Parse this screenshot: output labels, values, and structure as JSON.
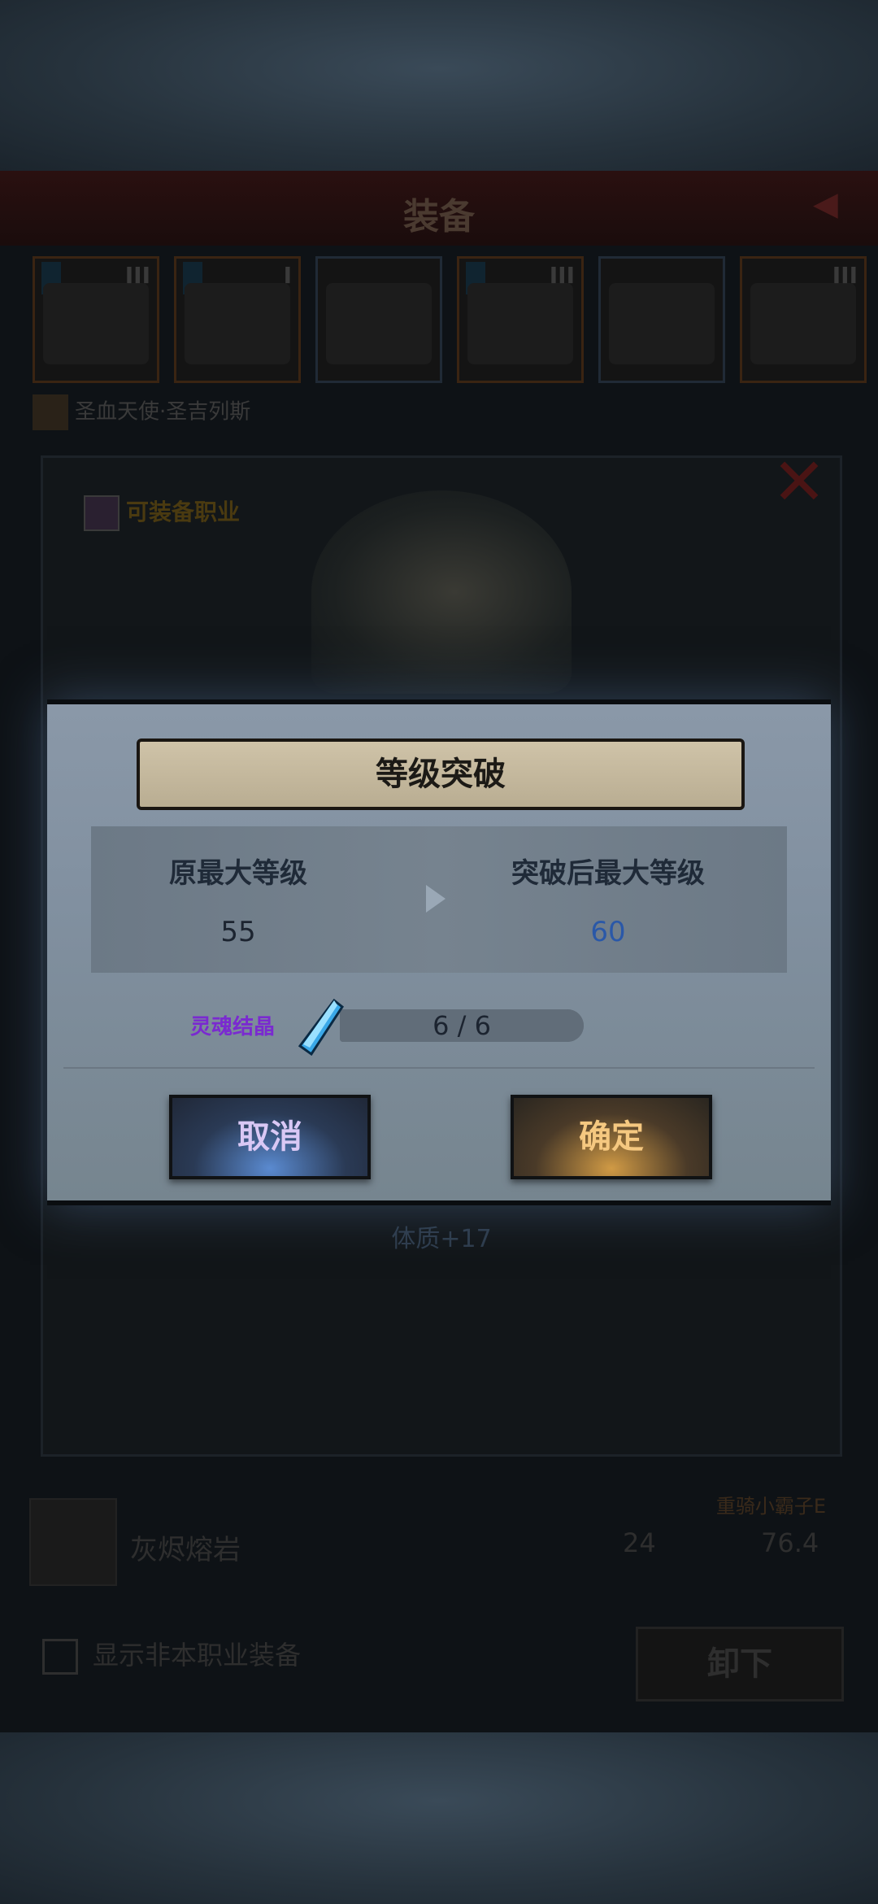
{
  "background_screen": {
    "title": "装备",
    "slots": [
      {
        "tier": "III",
        "pinned": true
      },
      {
        "tier": "I",
        "pinned": true
      },
      {
        "tier": "",
        "pinned": false
      },
      {
        "tier": "III",
        "pinned": true
      },
      {
        "tier": "",
        "pinned": false
      },
      {
        "tier": "III",
        "pinned": false
      }
    ],
    "hero_name": "圣血天使·圣吉列斯",
    "equipment_item": {
      "name": "灰烬熔岩",
      "level": "24",
      "score": "76.4",
      "owner": "重骑小霸子E"
    },
    "show_other_class_label": "显示非本职业装备",
    "unequip_label": "卸下"
  },
  "detail_panel": {
    "job_label": "可装备职业",
    "stat_line": "体质+17"
  },
  "dialog": {
    "title": "等级突破",
    "current_max_label": "原最大等级",
    "current_max_value": "55",
    "new_max_label": "突破后最大等级",
    "new_max_value": "60",
    "material": {
      "name": "灵魂结晶",
      "count": "6 / 6",
      "have": 6,
      "need": 6
    },
    "cancel_label": "取消",
    "confirm_label": "确定"
  },
  "colors": {
    "material_name": "#7a2ad0",
    "new_level": "#2a58a8",
    "cancel_text": "#d9c8f5",
    "confirm_text": "#f5c880"
  },
  "icons": [
    "close-icon",
    "job-icon",
    "crystal-icon",
    "arrow-right-icon",
    "helmet-icon"
  ]
}
